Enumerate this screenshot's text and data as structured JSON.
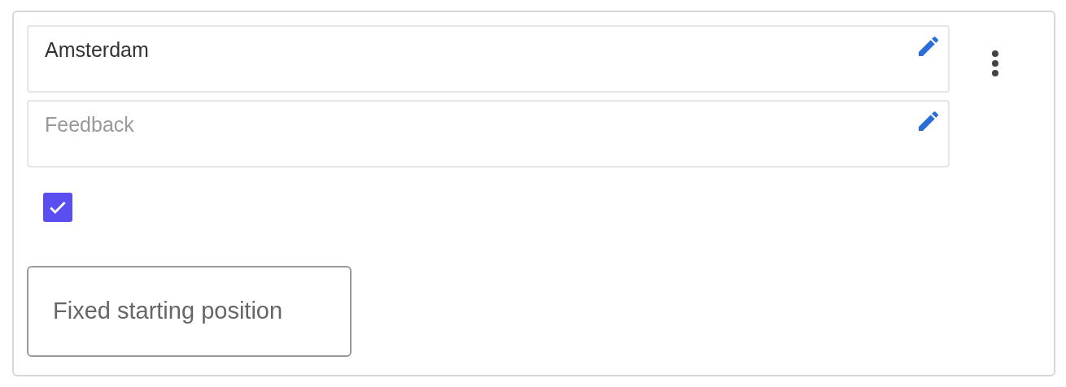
{
  "fields": [
    {
      "value": "Amsterdam"
    },
    {
      "placeholder": "Feedback"
    }
  ],
  "checkbox": {
    "checked": true
  },
  "button": {
    "label": "Fixed starting position"
  }
}
